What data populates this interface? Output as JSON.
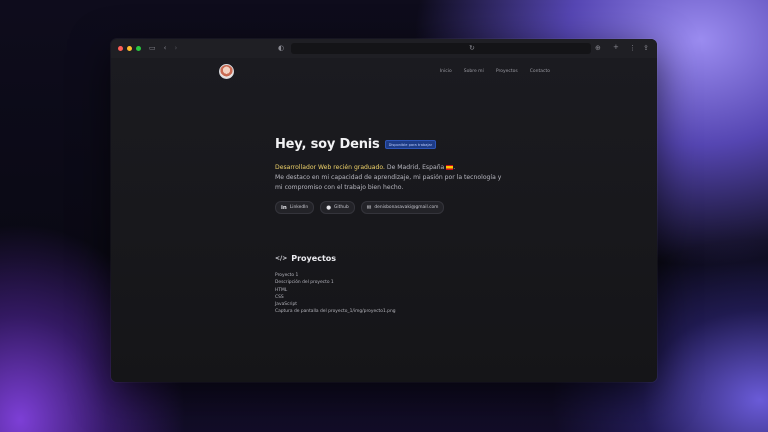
{
  "browser": {
    "traffic_lights": [
      "#ff5f57",
      "#febc2e",
      "#28c840"
    ],
    "address": ""
  },
  "nav": {
    "items": [
      "Inicio",
      "Sobre mí",
      "Proyectos",
      "Contacto"
    ]
  },
  "hero": {
    "title": "Hey, soy Denis",
    "badge": "Disponible para trabajar",
    "bio_highlight": "Desarrollador Web recién graduado.",
    "bio_location": " De Madrid, España",
    "bio_rest": "Me destaco en mi capacidad de aprendizaje, mi pasión por la tecnología y mi compromiso con el trabajo bien hecho."
  },
  "links": [
    {
      "label": "LinkedIn",
      "icon": "linkedin-icon",
      "glyph": "in"
    },
    {
      "label": "Github",
      "icon": "github-icon",
      "glyph": "●"
    },
    {
      "label": "denisbonasavaki@gmail.com",
      "icon": "mail-icon",
      "glyph": "✉"
    }
  ],
  "projects": {
    "heading": "Proyectos",
    "items": [
      "Proyecto 1",
      "Descripción del proyecto 1",
      "HTML",
      "CSS",
      "JavaScript",
      "Captura de pantalla del proyecto_1/img/proyecto1.png"
    ]
  },
  "colors": {
    "accent_highlight": "#f0d36a",
    "badge_bg": "#1d3b86"
  }
}
